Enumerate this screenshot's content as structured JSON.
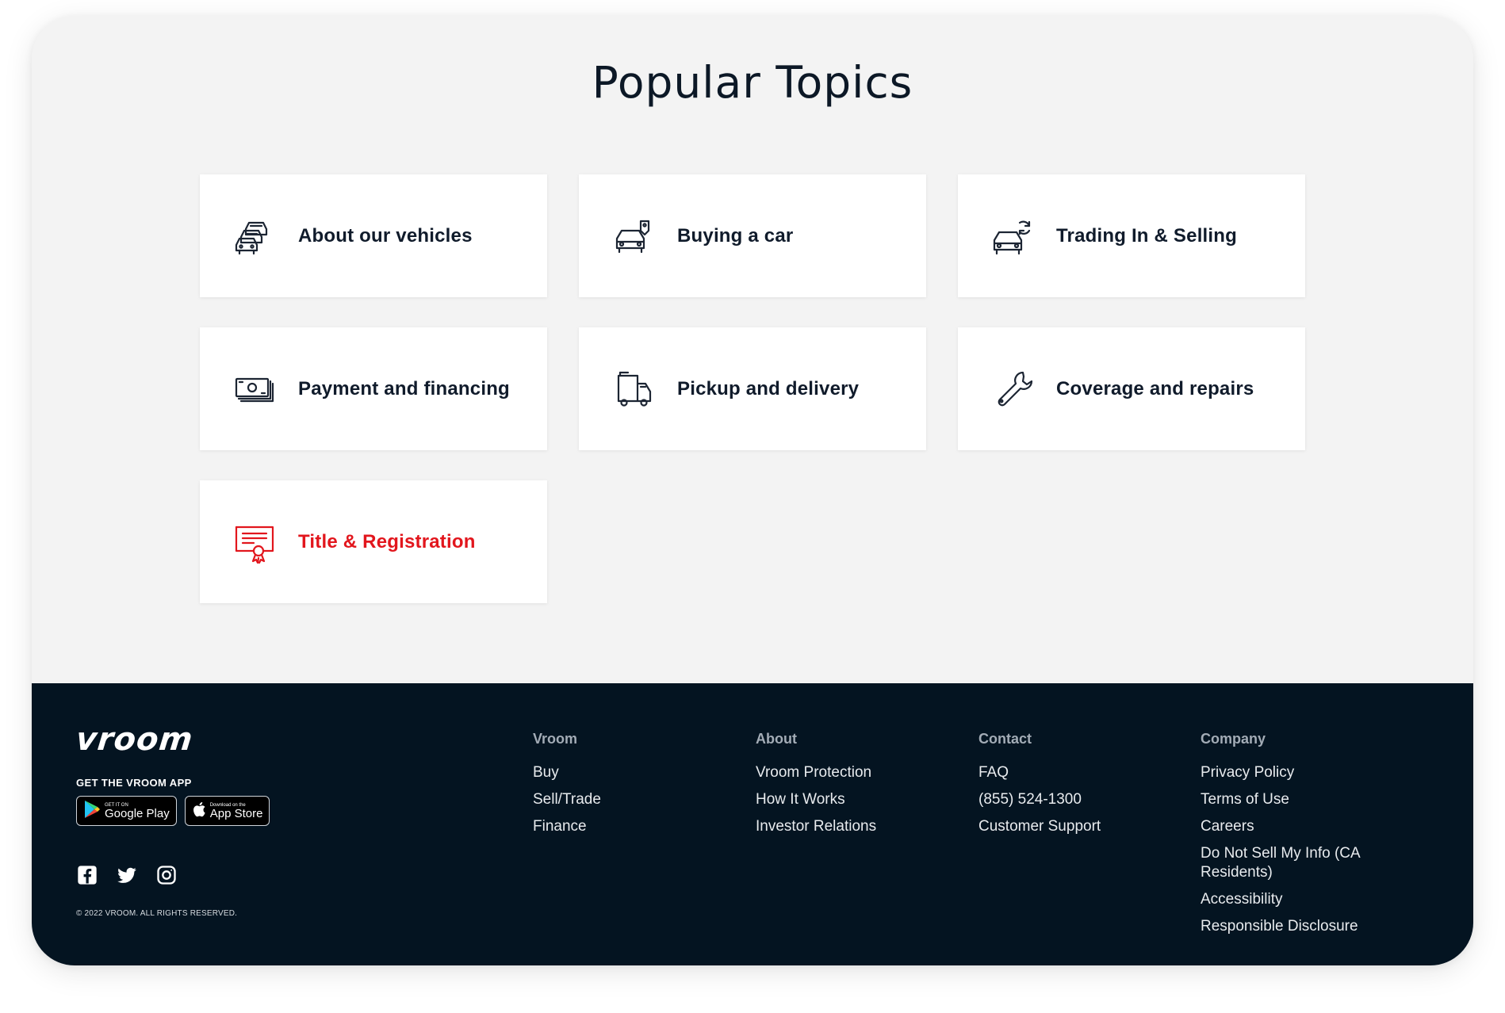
{
  "popular_topics": {
    "title": "Popular Topics",
    "cards": [
      {
        "label": "About our vehicles",
        "icon": "cars-stack-icon"
      },
      {
        "label": "Buying a car",
        "icon": "car-tag-icon"
      },
      {
        "label": "Trading In & Selling",
        "icon": "car-exchange-icon"
      },
      {
        "label": "Payment and financing",
        "icon": "cash-icon"
      },
      {
        "label": "Pickup and delivery",
        "icon": "truck-icon"
      },
      {
        "label": "Coverage and repairs",
        "icon": "wrench-icon"
      },
      {
        "label": "Title & Registration",
        "icon": "certificate-icon",
        "active": true
      }
    ]
  },
  "footer": {
    "logo": "vroom",
    "app_label": "GET THE VROOM APP",
    "badges": {
      "google_small": "GET IT ON",
      "google_big": "Google Play",
      "apple_small": "Download on the",
      "apple_big": "App Store"
    },
    "social": [
      "facebook-icon",
      "twitter-icon",
      "instagram-icon"
    ],
    "copyright": "© 2022 VROOM. ALL RIGHTS RESERVED.",
    "columns": [
      {
        "heading": "Vroom",
        "links": [
          "Buy",
          "Sell/Trade",
          "Finance"
        ]
      },
      {
        "heading": "About",
        "links": [
          "Vroom Protection",
          "How It Works",
          "Investor Relations"
        ]
      },
      {
        "heading": "Contact",
        "links": [
          "FAQ",
          "(855) 524-1300",
          "Customer Support"
        ]
      },
      {
        "heading": "Company",
        "links": [
          "Privacy Policy",
          "Terms of Use",
          "Careers",
          "Do Not Sell My Info (CA Residents)",
          "Accessibility",
          "Responsible Disclosure"
        ]
      }
    ]
  },
  "colors": {
    "page_bg": "#f3f3f3",
    "footer_bg": "#041421",
    "accent_red": "#e2161d",
    "text_dark": "#101b2b"
  }
}
